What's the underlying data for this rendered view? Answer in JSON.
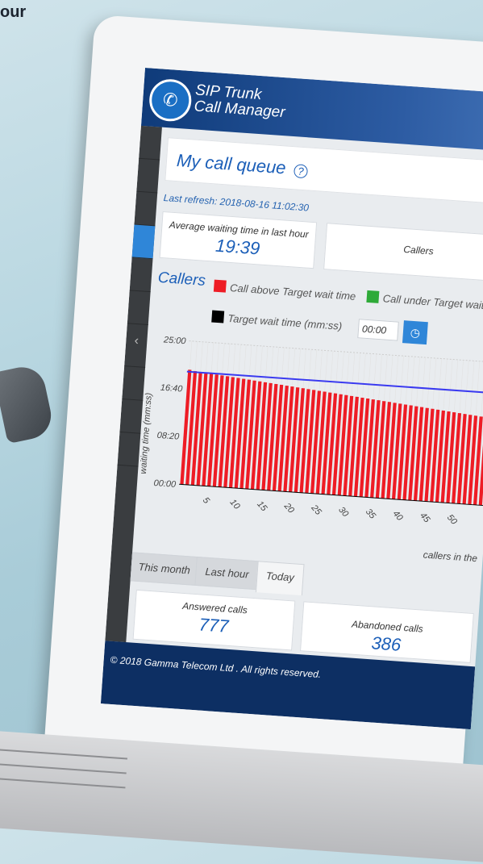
{
  "page": {
    "corner_text": "our"
  },
  "app": {
    "brand_line1": "SIP Trunk",
    "brand_line2": "Call Manager"
  },
  "page_title": "My call queue",
  "help_symbol": "?",
  "last_refresh": "Last refresh: 2018-08-16 11:02:30",
  "stats": {
    "avg_wait_label": "Average waiting time in last hour",
    "avg_wait_value": "19:39",
    "callers_label": "Callers"
  },
  "callers_section": {
    "title": "Callers",
    "legend_above": "Call above Target wait time",
    "legend_under": "Call under Target wait time",
    "legend_target": "Target wait time (mm:ss)",
    "target_value": "00:00",
    "colors": {
      "above": "#ee1c25",
      "under": "#2eaa38",
      "target": "#000000",
      "line": "#3a3af0"
    }
  },
  "chart_data": {
    "type": "bar",
    "ylabel": "waiting time (mm:ss)",
    "xlabel": "callers in the",
    "y_ticks": [
      "00:00",
      "08:20",
      "16:40",
      "25:00"
    ],
    "ylim_seconds": [
      0,
      1500
    ],
    "x_ticks": [
      "5",
      "10",
      "15",
      "20",
      "25",
      "30",
      "35",
      "40",
      "45",
      "50"
    ],
    "average_line_seconds": 1179,
    "values_seconds": [
      1200,
      1190,
      1185,
      1180,
      1175,
      1170,
      1165,
      1160,
      1155,
      1150,
      1145,
      1140,
      1135,
      1130,
      1125,
      1120,
      1115,
      1110,
      1105,
      1100,
      1095,
      1090,
      1085,
      1080,
      1075,
      1070,
      1065,
      1060,
      1055,
      1050,
      1045,
      1040,
      1035,
      1030,
      1025,
      1020,
      1015,
      1010,
      1005,
      1000,
      995,
      990,
      985,
      980,
      975,
      970,
      965,
      960,
      955,
      950,
      945,
      940,
      935,
      930,
      925,
      920
    ]
  },
  "tabs": [
    "This month",
    "Last hour",
    "Today"
  ],
  "summary": {
    "answered_label": "Answered calls",
    "answered_value": "777",
    "abandoned_label": "Abandoned calls",
    "abandoned_value": "386"
  },
  "footer": {
    "text": "© 2018 Gamma Telecom Ltd . All rights reserved."
  }
}
